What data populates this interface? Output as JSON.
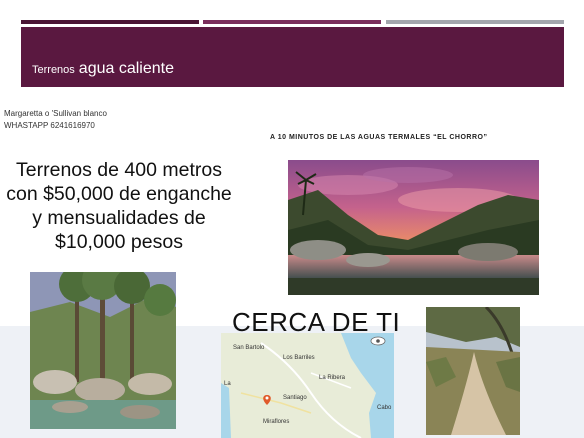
{
  "header": {
    "title_small": "Terrenos",
    "title_large": "agua caliente"
  },
  "contact": {
    "name": "Margaretta o 'Sullivan blanco",
    "phone": "WHASTAPP 6241616970"
  },
  "subtitle": "A 10 MINUTOS DE LAS AGUAS TERMALES “EL CHORRO”",
  "offer": {
    "line1": "Terrenos de 400 metros",
    "line2": "con $50,000 de enganche",
    "line3": "y mensualidades de",
    "line4": "$10,000 pesos"
  },
  "cerca": "CERCA DE TI",
  "map": {
    "labels": [
      "San Bartolo",
      "Los Barriles",
      "La Ribera",
      "Santiago",
      "Miraflores",
      "Cabo",
      "La"
    ]
  },
  "colors": {
    "header_bg": "#5a1840",
    "bar1": "#4a1535",
    "bar2": "#7a2e5c",
    "bar3": "#a3a6ad"
  }
}
